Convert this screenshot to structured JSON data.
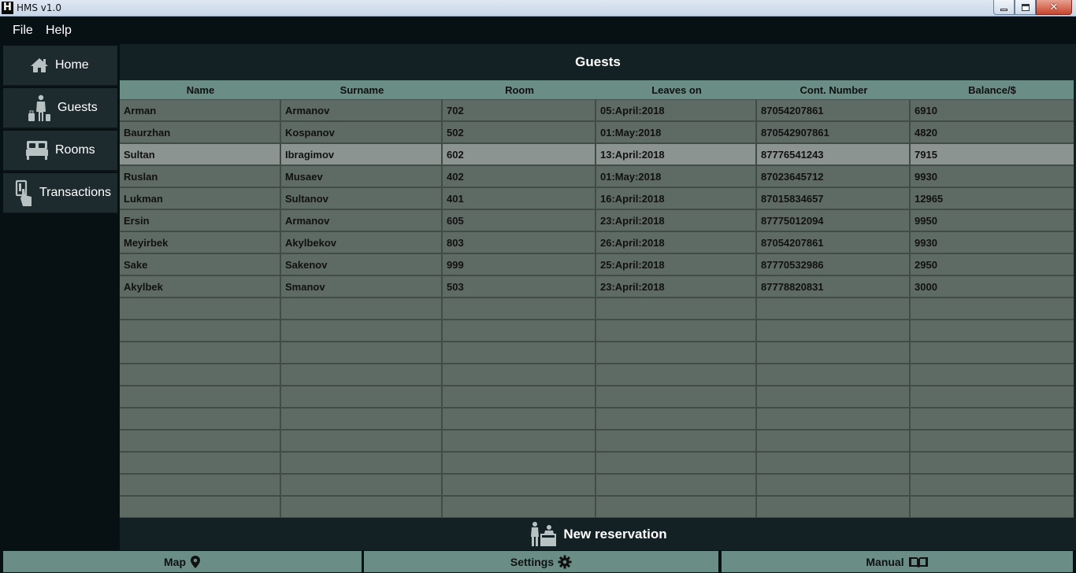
{
  "window": {
    "icon_letter": "H",
    "title": "HMS v1.0"
  },
  "menu": {
    "file": "File",
    "help": "Help"
  },
  "sidebar": {
    "items": [
      {
        "label": "Home",
        "icon": "home-icon"
      },
      {
        "label": "Guests",
        "icon": "guest-luggage-icon"
      },
      {
        "label": "Rooms",
        "icon": "bed-icon"
      },
      {
        "label": "Transactions",
        "icon": "card-payment-icon"
      }
    ]
  },
  "main": {
    "title": "Guests",
    "columns": [
      "Name",
      "Surname",
      "Room",
      "Leaves on",
      "Cont. Number",
      "Balance/$"
    ],
    "rows": [
      [
        "Arman",
        "Armanov",
        "702",
        "05:April:2018",
        "87054207861",
        "6910"
      ],
      [
        "Baurzhan",
        "Kospanov",
        "502",
        "01:May:2018",
        "870542907861",
        "4820"
      ],
      [
        "Sultan",
        "Ibragimov",
        "602",
        "13:April:2018",
        "87776541243",
        "7915"
      ],
      [
        "Ruslan",
        "Musaev",
        "402",
        "01:May:2018",
        "87023645712",
        "9930"
      ],
      [
        "Lukman",
        "Sultanov",
        "401",
        "16:April:2018",
        "87015834657",
        "12965"
      ],
      [
        "Ersin",
        "Armanov",
        "605",
        "23:April:2018",
        "87775012094",
        "9950"
      ],
      [
        "Meyirbek",
        "Akylbekov",
        "803",
        "26:April:2018",
        "87054207861",
        "9930"
      ],
      [
        "Sake",
        "Sakenov",
        "999",
        "25:April:2018",
        "87770532986",
        "2950"
      ],
      [
        "Akylbek",
        "Smanov",
        "503",
        "23:April:2018",
        "87778820831",
        "3000"
      ]
    ],
    "selected_row": 2,
    "empty_rows": 10,
    "new_reservation": "New reservation"
  },
  "bottom": {
    "map": "Map",
    "settings": "Settings",
    "manual": "Manual"
  },
  "colors": {
    "background": "#071012",
    "panel": "#132024",
    "header_accent": "#6a8e85",
    "row": "#5e6a64",
    "selected_row": "#8b9491"
  }
}
